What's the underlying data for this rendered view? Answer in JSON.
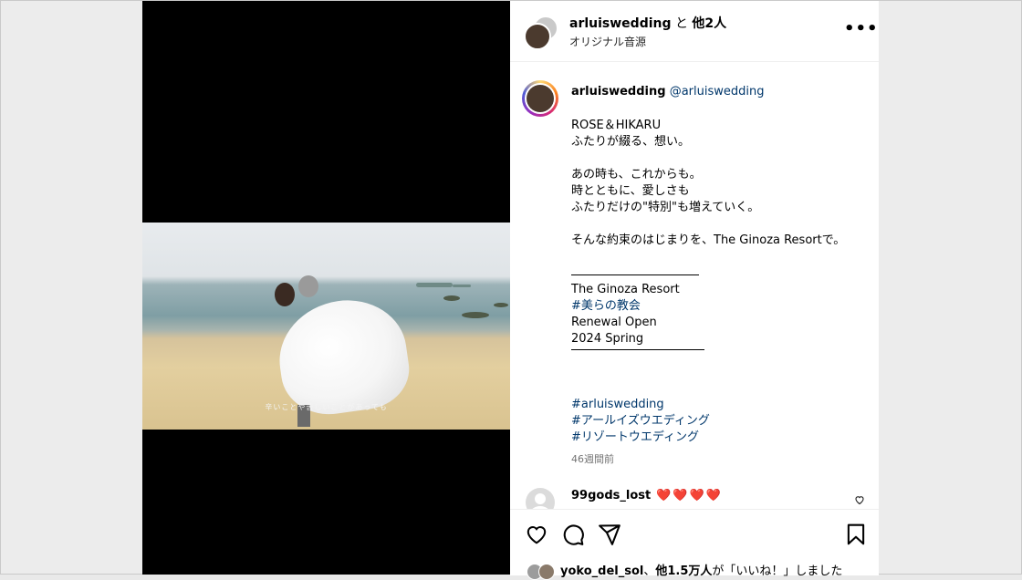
{
  "header": {
    "username": "arluiswedding",
    "and_text": " と ",
    "others": "他2人",
    "audio": "オリジナル音源",
    "more_icon": "more-horizontal-icon"
  },
  "media": {
    "subtitle": "辛いことや苦しいことがあっても"
  },
  "caption": {
    "username": "arluiswedding",
    "mention": "@arluiswedding",
    "lines": [
      "ROSE＆HIKARU",
      "ふたりが綴る、想い。",
      "",
      "あの時も、これからも。",
      "時とともに、愛しさも",
      "ふたりだけの\"特別\"も増えていく。",
      "",
      "そんな約束のはじまりを、The Ginoza Resortで。",
      ""
    ],
    "venue": "The Ginoza Resort",
    "tag_church": "#美らの教会",
    "renewal": "Renewal Open",
    "season": "2024 Spring",
    "hashtags": [
      "#arluiswedding",
      "#アールイズウエディング",
      "#リゾートウエディング"
    ],
    "time": "46週間前"
  },
  "comment": {
    "username": "99gods_lost",
    "text": "❤️❤️❤️❤️"
  },
  "actions": {
    "icons": [
      "heart-icon",
      "comment-icon",
      "share-icon",
      "bookmark-icon"
    ]
  },
  "likes": {
    "user": "yoko_del_sol",
    "sep": "、",
    "count": "他1.5万人",
    "suffix": "が「いいね！」しました"
  },
  "colors": {
    "link": "#00376b",
    "heart": "#e0102f",
    "muted": "#737373"
  }
}
